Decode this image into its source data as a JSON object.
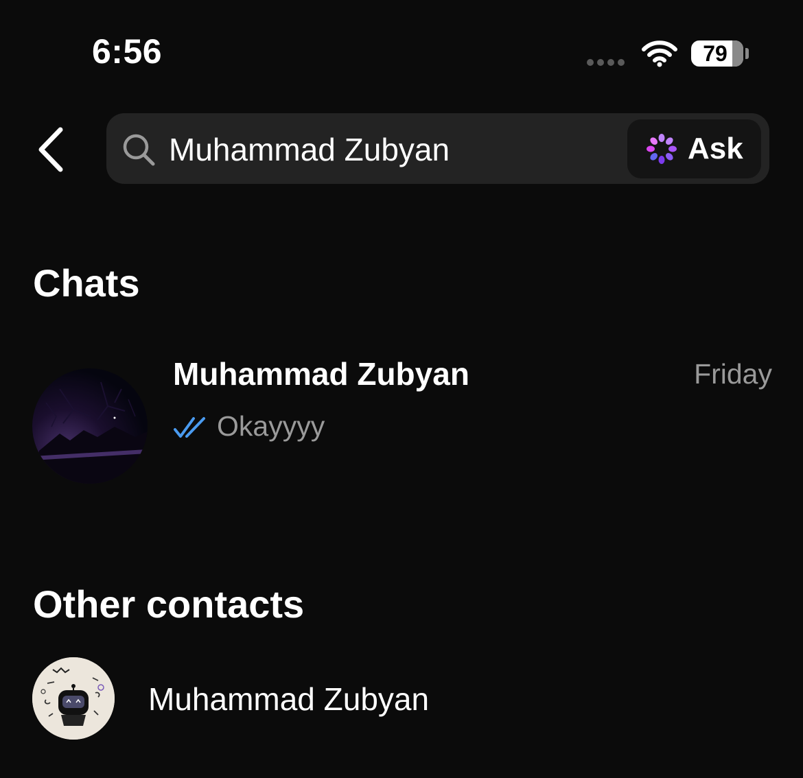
{
  "status_bar": {
    "time": "6:56",
    "battery_level": "79",
    "battery_fraction": 0.79,
    "icons": [
      "signal-dots-icon",
      "wifi-icon",
      "battery-icon"
    ]
  },
  "header": {
    "back_icon": "chevron-left-icon",
    "search": {
      "icon": "search-icon",
      "value": "Muhammad Zubyan"
    },
    "ask": {
      "icon": "meta-ai-icon",
      "label": "Ask"
    }
  },
  "sections": {
    "chats_title": "Chats",
    "other_contacts_title": "Other contacts"
  },
  "chats": [
    {
      "name": "Muhammad Zubyan",
      "date": "Friday",
      "last_message": "Okayyyy",
      "status_icon": "double-check-read-icon"
    }
  ],
  "contacts": [
    {
      "name": "Muhammad Zubyan"
    }
  ],
  "colors": {
    "background": "#0b0b0b",
    "search_bg": "#232323",
    "muted_text": "#9a9a9a",
    "read_tick": "#4a9bf0",
    "ask_accent": "#a855f7"
  }
}
